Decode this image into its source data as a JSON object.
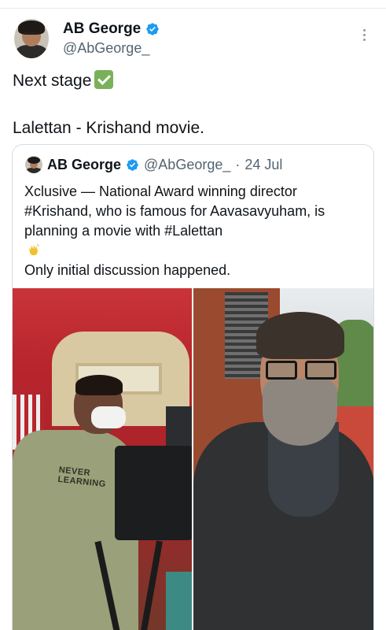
{
  "tweet": {
    "author": {
      "display_name": "AB George",
      "handle": "@AbGeorge_",
      "verified": true
    },
    "text_lines": [
      "Next stage",
      "Lalettan - Krishand movie."
    ],
    "text_emoji": "check-mark-button",
    "more_icon": "more-options-icon"
  },
  "quoted": {
    "author": {
      "display_name": "AB George",
      "handle": "@AbGeorge_",
      "separator": "·",
      "date": "24 Jul"
    },
    "body_lines": [
      "Xclusive — National Award winning director",
      "#Krishand, who is famous for Aavasavyuham, is",
      "planning a movie with #Lalettan",
      "Only initial discussion happened.",
      "..."
    ],
    "body_emoji": "clapping-hands",
    "media": {
      "left_image_text": "LEARNING",
      "left_image_text_top": "NEVER"
    }
  },
  "colors": {
    "verified_blue": "#1d9bf0",
    "secondary_text": "#536471",
    "border": "#d7dde2"
  }
}
